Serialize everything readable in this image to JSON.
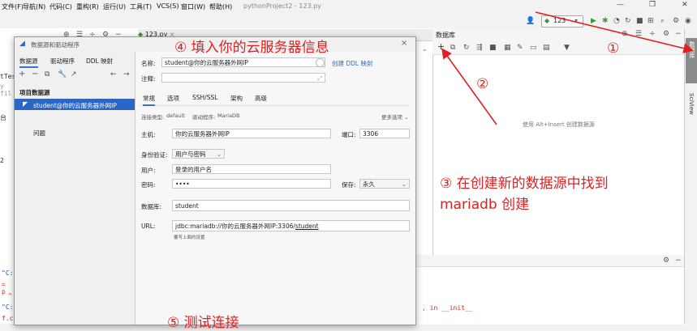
{
  "menubar": {
    "items": [
      "文件(F)",
      "导航(N)",
      "代码(C)",
      "重构(R)",
      "运行(U)",
      "工具(T)",
      "VCS(S)",
      "窗口(W)",
      "帮助(H)"
    ],
    "title": "pythonProject2 - 123.py",
    "window_controls": [
      "—",
      "❐",
      "✕"
    ]
  },
  "toolbar": {
    "run_config": "123"
  },
  "editor": {
    "tab": "123.py",
    "left_code_fragments": [
      "tTes",
      "y fil",
      "台",
      "2"
    ]
  },
  "db_panel": {
    "title": "数据库",
    "empty_hint": "使用 Alt+Insert 创建数据源"
  },
  "right_strip": {
    "labels": [
      "数据库",
      "SciView"
    ]
  },
  "bottom": {
    "code_lines": [
      "\"C:",
      "= p",
      "^",
      "\"C:",
      "f.c"
    ],
    "trace_text": ", in __init__"
  },
  "dialog": {
    "title": "数据源和驱动程序",
    "tabs": [
      "数据源",
      "驱动程序",
      "DDL 映射"
    ],
    "section_label": "项目数据源",
    "selected_source": "student@你的云服务器外网IP",
    "problems_label": "问题",
    "name_label": "名称:",
    "name_value": "student@你的云服务器外网IP",
    "create_ddl_link": "创建 DDL 映射",
    "comment_label": "注释:",
    "config_tabs": [
      "常规",
      "选项",
      "SSH/SSL",
      "架构",
      "高级"
    ],
    "conn_type_label": "连接类型:",
    "conn_type_value": "default",
    "driver_label": "驱动程序:",
    "driver_value": "MariaDB",
    "more_options": "更多选项 ⌄",
    "host_label": "主机:",
    "host_value": "你的云服务器外网IP",
    "port_label": "端口:",
    "port_value": "3306",
    "auth_label": "身份验证:",
    "auth_value": "用户与密码",
    "user_label": "用户:",
    "user_value": "登录的用户名",
    "password_label": "密码:",
    "password_value": "••••",
    "save_label": "保存:",
    "save_value": "永久",
    "database_label": "数据库:",
    "database_value": "student",
    "url_label": "URL:",
    "url_value_prefix": "jdbc:mariadb://你的云服务器外网IP:3306/",
    "url_value_db": "student",
    "url_hint": "覆写上面的设置"
  },
  "annotations": {
    "step1": "①",
    "step2": "②",
    "step3_line1": "③ 在创建新的数据源中找到",
    "step3_line2": "mariadb 创建",
    "step4": "④ 填入你的云服务器信息",
    "step5": "⑤ 测试连接"
  },
  "colors": {
    "annotation_red": "#e02020",
    "selection_blue": "#2a66c7",
    "link_blue": "#2f6fc4",
    "run_green": "#3a9a3a"
  }
}
